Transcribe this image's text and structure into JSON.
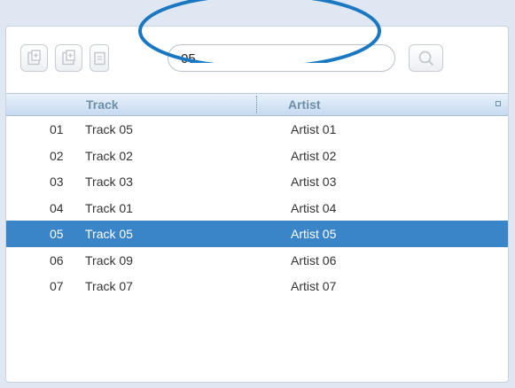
{
  "toolbar": {
    "buttons": [
      {
        "icon": "add-file-icon"
      },
      {
        "icon": "add-file-icon"
      },
      {
        "icon": "file-icon"
      }
    ],
    "search": {
      "value": "05",
      "icon": "search-icon"
    }
  },
  "table": {
    "columns": [
      "Track",
      "Artist"
    ],
    "rows": [
      {
        "num": "01",
        "track": "Track 05",
        "artist": "Artist 01",
        "selected": false
      },
      {
        "num": "02",
        "track": "Track 02",
        "artist": "Artist 02",
        "selected": false
      },
      {
        "num": "03",
        "track": "Track 03",
        "artist": "Artist 03",
        "selected": false
      },
      {
        "num": "04",
        "track": "Track 01",
        "artist": "Artist 04",
        "selected": false
      },
      {
        "num": "05",
        "track": "Track 05",
        "artist": "Artist 05",
        "selected": true
      },
      {
        "num": "06",
        "track": "Track 09",
        "artist": "Artist 06",
        "selected": false
      },
      {
        "num": "07",
        "track": "Track 07",
        "artist": "Artist 07",
        "selected": false
      }
    ]
  },
  "colors": {
    "selection": "#3a84c8",
    "annotation": "#1a78c2",
    "header_text": "#6f8fa8"
  }
}
